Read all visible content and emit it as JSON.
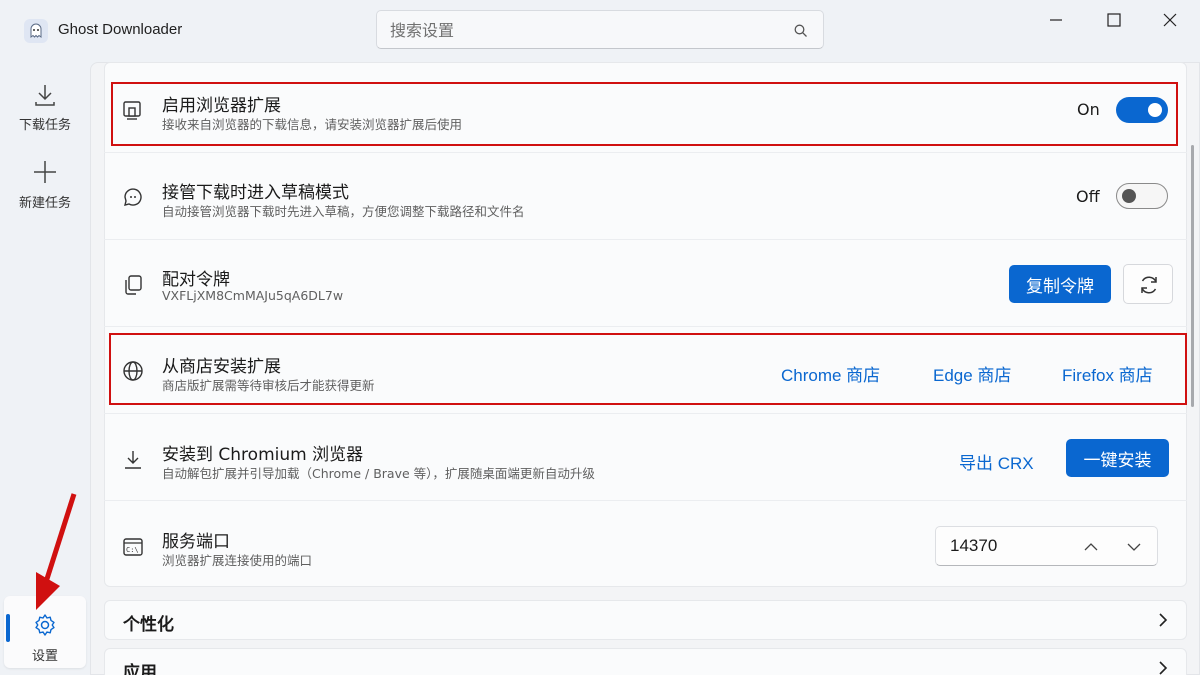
{
  "app": {
    "title": "Ghost Downloader"
  },
  "search": {
    "placeholder": "搜索设置"
  },
  "rail": {
    "downloads_label": "下载任务",
    "new_task_label": "新建任务",
    "settings_label": "设置"
  },
  "settings": {
    "browser_ext": {
      "title": "启用浏览器扩展",
      "desc": "接收来自浏览器的下载信息，请安装浏览器扩展后使用",
      "state_label": "On",
      "enabled": true
    },
    "draft_mode": {
      "title": "接管下载时进入草稿模式",
      "desc": "自动接管浏览器下载时先进入草稿，方便您调整下载路径和文件名",
      "state_label": "Off",
      "enabled": false
    },
    "pair_token": {
      "title": "配对令牌",
      "desc": "VXFLjXM8CmMAJu5qA6DL7w",
      "copy_label": "复制令牌"
    },
    "store_install": {
      "title": "从商店安装扩展",
      "desc": "商店版扩展需等待审核后才能获得更新",
      "chrome_link": "Chrome 商店",
      "edge_link": "Edge 商店",
      "firefox_link": "Firefox 商店"
    },
    "chromium_install": {
      "title": "安装到 Chromium 浏览器",
      "desc": "自动解包扩展并引导加载（Chrome / Brave 等），扩展随桌面端更新自动升级",
      "export_label": "导出 CRX",
      "install_label": "一键安装"
    },
    "service_port": {
      "title": "服务端口",
      "desc": "浏览器扩展连接使用的端口",
      "value": "14370"
    }
  },
  "sections": {
    "personalize": "个性化",
    "apps": "应用"
  },
  "colors": {
    "accent": "#0a67d0",
    "highlight": "#d01010"
  }
}
